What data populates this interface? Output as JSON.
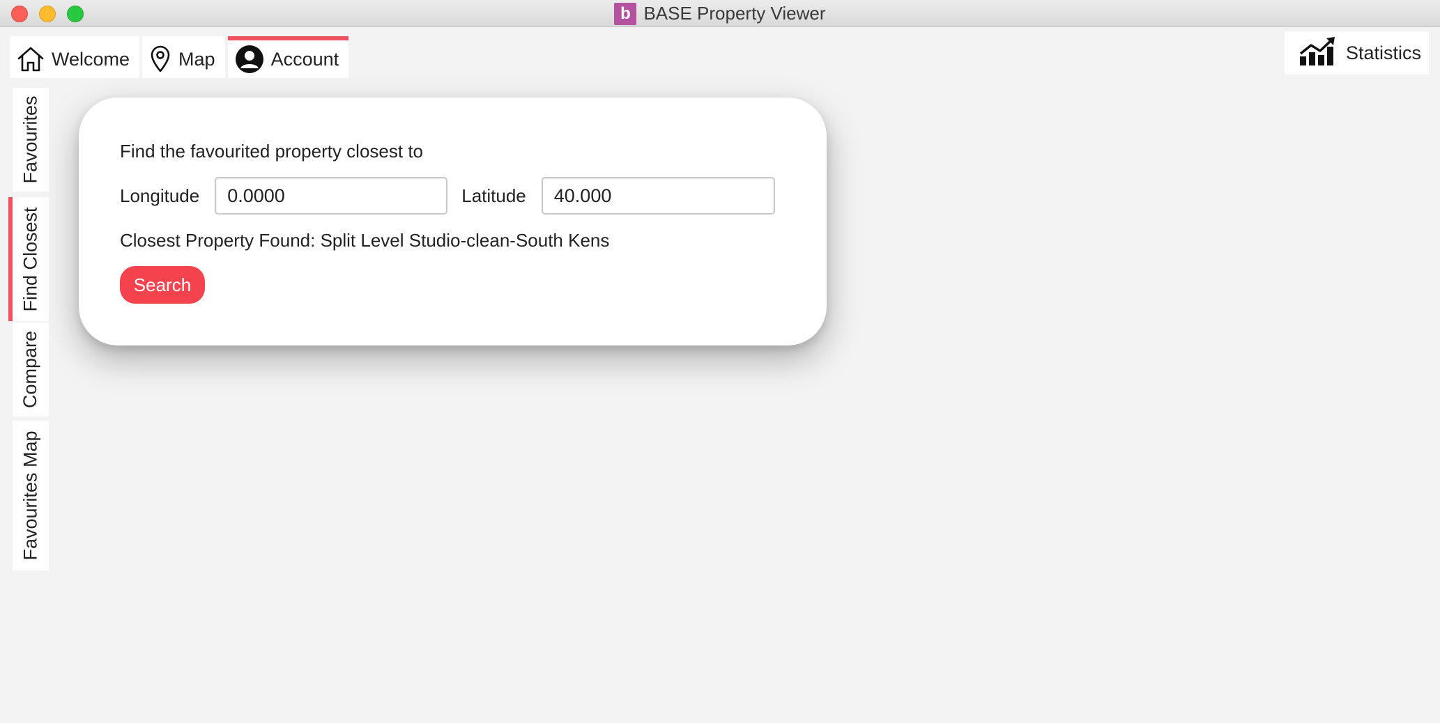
{
  "window": {
    "title": "BASE Property Viewer",
    "logo_letter": "b",
    "logo_color": "#b5529f"
  },
  "tabs": [
    {
      "label": "Welcome",
      "icon": "home-icon",
      "active": false
    },
    {
      "label": "Map",
      "icon": "map-pin-icon",
      "active": false
    },
    {
      "label": "Account",
      "icon": "user-icon",
      "active": true
    }
  ],
  "statistics_button": {
    "label": "Statistics",
    "icon": "chart-icon"
  },
  "side_tabs": [
    {
      "label": "Favourites",
      "active": false
    },
    {
      "label": "Find Closest",
      "active": true
    },
    {
      "label": "Compare",
      "active": false
    },
    {
      "label": "Favourites Map",
      "active": false
    }
  ],
  "find_closest": {
    "heading": "Find the favourited property closest to",
    "longitude_label": "Longitude",
    "longitude_value": "0.0000",
    "latitude_label": "Latitude",
    "latitude_value": "40.000",
    "result_text": "Closest Property Found: Split Level Studio-clean-South Kens",
    "search_label": "Search"
  },
  "colors": {
    "accent": "#f0535f",
    "button": "#f4434d"
  }
}
